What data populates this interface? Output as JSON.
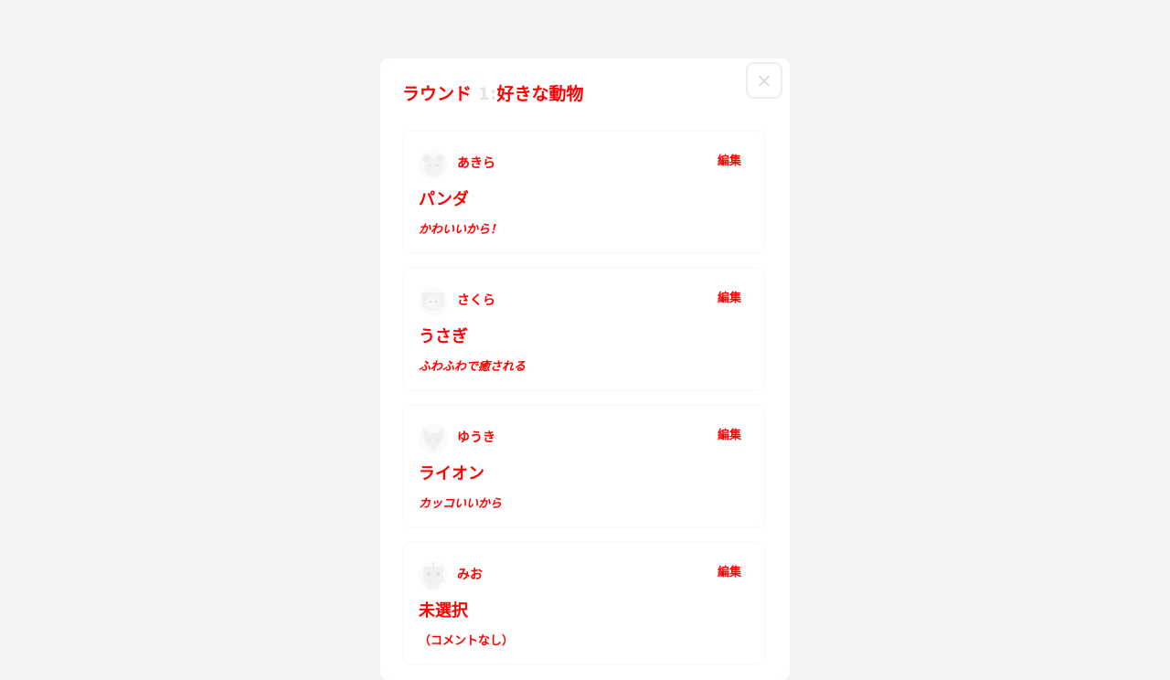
{
  "modal": {
    "title_prefix": "ラウンド ",
    "round_number": "1:",
    "title_topic": "好きな動物",
    "close_label": "×"
  },
  "cards": [
    {
      "avatar_icon": "bear-icon",
      "name": "あきら",
      "edit_label": "編集",
      "answer": "パンダ",
      "comment": "かわいいから！"
    },
    {
      "avatar_icon": "lion-icon",
      "name": "さくら",
      "edit_label": "編集",
      "answer": "うさぎ",
      "comment": "ふわふわで癒される"
    },
    {
      "avatar_icon": "fox-icon",
      "name": "ゆうき",
      "edit_label": "編集",
      "answer": "ライオン",
      "comment": "カッコいいから"
    },
    {
      "avatar_icon": "robot-icon",
      "name": "みお",
      "edit_label": "編集",
      "answer": "未選択",
      "comment": "（コメントなし）"
    }
  ],
  "colors": {
    "page_background": "#f4f4f4",
    "text_highlight": "#ff0000",
    "faint": "#e4e4e4"
  }
}
